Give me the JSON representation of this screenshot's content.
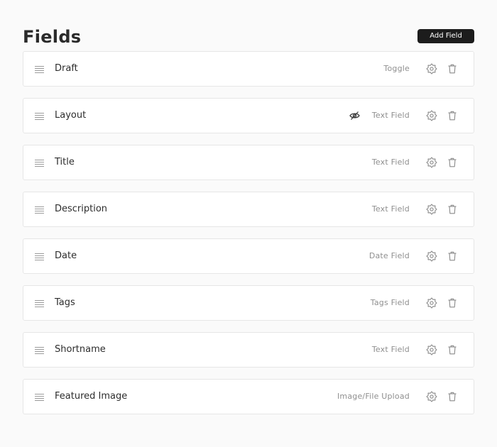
{
  "header": {
    "title": "Fields",
    "add_button": "Add Field"
  },
  "fields": [
    {
      "name": "Draft",
      "type": "Toggle",
      "hidden": false
    },
    {
      "name": "Layout",
      "type": "Text Field",
      "hidden": true
    },
    {
      "name": "Title",
      "type": "Text Field",
      "hidden": false
    },
    {
      "name": "Description",
      "type": "Text Field",
      "hidden": false
    },
    {
      "name": "Date",
      "type": "Date Field",
      "hidden": false
    },
    {
      "name": "Tags",
      "type": "Tags Field",
      "hidden": false
    },
    {
      "name": "Shortname",
      "type": "Text Field",
      "hidden": false
    },
    {
      "name": "Featured Image",
      "type": "Image/File Upload",
      "hidden": false
    }
  ],
  "icons": {
    "drag": "drag-handle-icon",
    "hidden": "eye-off-icon",
    "settings": "gear-icon",
    "delete": "trash-icon"
  },
  "colors": {
    "button_bg": "#1c1c1c",
    "button_text": "#ffffff",
    "type_text": "#8f8f8f"
  }
}
